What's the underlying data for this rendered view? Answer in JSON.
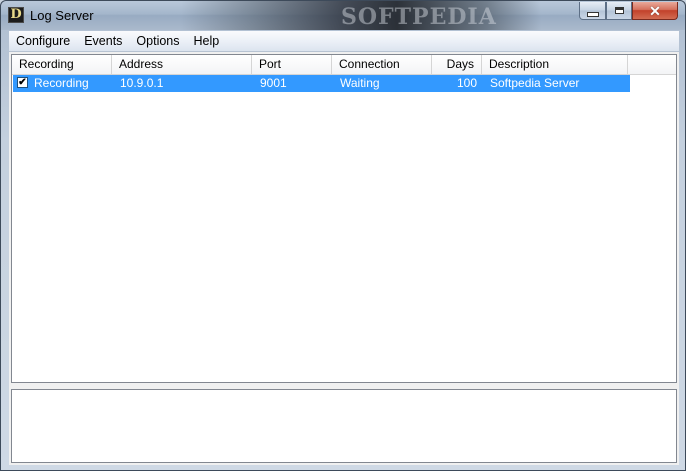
{
  "window": {
    "title": "Log Server",
    "app_icon_letter": "D",
    "watermark": "SOFTPEDIA",
    "minimize_glyph": "",
    "close_glyph": "✕"
  },
  "menu": {
    "items": [
      "Configure",
      "Events",
      "Options",
      "Help"
    ]
  },
  "list": {
    "columns": [
      "Recording",
      "Address",
      "Port",
      "Connection",
      "Days",
      "Description"
    ],
    "rows": [
      {
        "checked": true,
        "check_glyph": "✔",
        "recording": "Recording",
        "address": "10.9.0.1",
        "port": "9001",
        "connection": "Waiting",
        "days": "100",
        "description": "Softpedia Server"
      }
    ]
  },
  "log": {
    "text": ""
  }
}
